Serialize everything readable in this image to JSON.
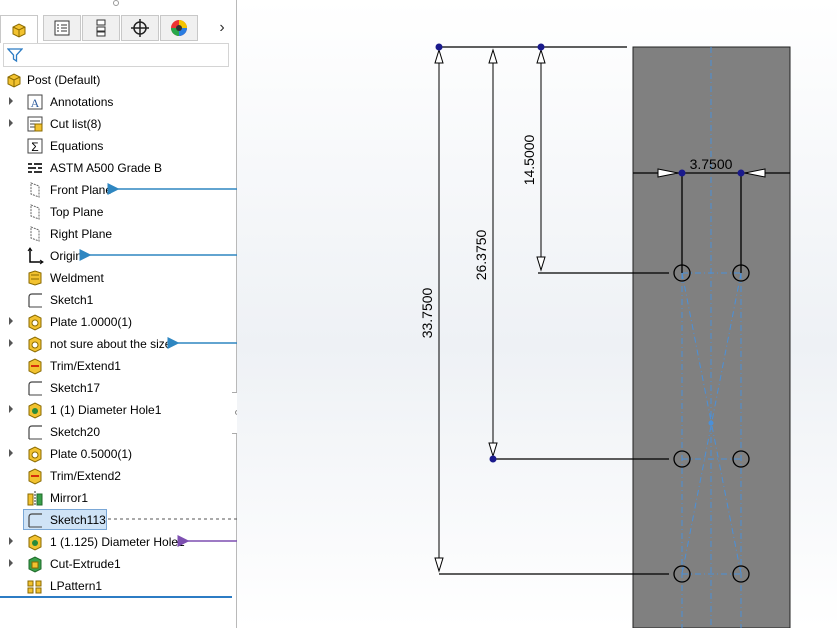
{
  "tabs": [
    {
      "name": "featuremanager-tab",
      "icon": "part-icon"
    },
    {
      "name": "propertymanager-tab",
      "icon": "property-icon"
    },
    {
      "name": "configurationmanager-tab",
      "icon": "configuration-icon"
    },
    {
      "name": "dimxpert-tab",
      "icon": "crosshair-icon"
    },
    {
      "name": "display-manager-tab",
      "icon": "color-wheel-icon"
    }
  ],
  "tree": {
    "root": "Post  (Default)",
    "items": [
      {
        "label": "Annotations",
        "icon": "annotations-icon",
        "expandable": true
      },
      {
        "label": "Cut list(8)",
        "icon": "cut-list-icon",
        "expandable": true
      },
      {
        "label": "Equations",
        "icon": "equations-icon",
        "expandable": false
      },
      {
        "label": "ASTM A500 Grade B",
        "icon": "material-icon",
        "expandable": false
      },
      {
        "label": "Front Plane",
        "icon": "plane-icon",
        "expandable": false
      },
      {
        "label": "Top Plane",
        "icon": "plane-icon",
        "expandable": false
      },
      {
        "label": "Right Plane",
        "icon": "plane-icon",
        "expandable": false
      },
      {
        "label": "Origin",
        "icon": "origin-icon",
        "expandable": false
      },
      {
        "label": "Weldment",
        "icon": "weldment-icon",
        "expandable": false
      },
      {
        "label": "Sketch1",
        "icon": "sketch-icon",
        "expandable": false
      },
      {
        "label": "Plate 1.0000(1)",
        "icon": "extrude-icon",
        "expandable": true
      },
      {
        "label": "not sure about the size",
        "icon": "extrude-icon",
        "expandable": true
      },
      {
        "label": "Trim/Extend1",
        "icon": "trim-icon",
        "expandable": false
      },
      {
        "label": "Sketch17",
        "icon": "sketch-icon",
        "expandable": false
      },
      {
        "label": "1 (1) Diameter Hole1",
        "icon": "hole-icon",
        "expandable": true
      },
      {
        "label": "Sketch20",
        "icon": "sketch-icon",
        "expandable": false
      },
      {
        "label": "Plate 0.5000(1)",
        "icon": "extrude-icon",
        "expandable": true
      },
      {
        "label": "Trim/Extend2",
        "icon": "trim-icon",
        "expandable": false
      },
      {
        "label": "Mirror1",
        "icon": "mirror-icon",
        "expandable": false
      },
      {
        "label": "Sketch113",
        "icon": "sketch-icon",
        "expandable": false,
        "selected": true
      },
      {
        "label": "1 (1.125) Diameter Hole1",
        "icon": "hole-icon",
        "expandable": true
      },
      {
        "label": "Cut-Extrude1",
        "icon": "cut-extrude-icon",
        "expandable": true
      },
      {
        "label": "LPattern1",
        "icon": "pattern-icon",
        "expandable": false
      }
    ]
  },
  "dimensions": {
    "horizontal": "3.7500",
    "vertical_short": "14.5000",
    "vertical_mid": "26.3750",
    "vertical_long": "33.7500"
  },
  "colors": {
    "accent": "#2c7cc4",
    "relation_blue": "#2e86c1",
    "relation_purple": "#7d4fb1",
    "part_gray": "#808080",
    "sketch_point": "#1a1a8c",
    "construction_line": "#4a90d9"
  }
}
